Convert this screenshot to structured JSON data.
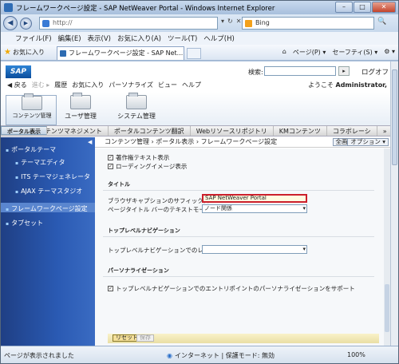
{
  "window": {
    "title": "フレームワークページ設定 - SAP NetWeaver Portal - Windows Internet Explorer",
    "min": "–",
    "max": "□",
    "close": "✕"
  },
  "addressbar": {
    "back_icon": "◀",
    "forward_icon": "▶",
    "url": "http://",
    "search_text": "Bing",
    "search_icon": "🔍",
    "icons": [
      "▾",
      "↻",
      "✕"
    ]
  },
  "menubar": [
    "ファイル(F)",
    "編集(E)",
    "表示(V)",
    "お気に入り(A)",
    "ツール(T)",
    "ヘルプ(H)"
  ],
  "favbar": {
    "favorites": "お気に入り",
    "tab_title": "フレームワークページ設定 - SAP Net...",
    "page_menu": "ページ(P) ▾",
    "safety_menu": "セーフティ(S) ▾",
    "tools_icon": "⚙ ▾"
  },
  "sap": {
    "logo": "SAP",
    "search_label": "検索:",
    "search_btn": "▸",
    "logoff": "ログオフ",
    "toolbar": {
      "back": "◀ 戻る",
      "forward": "進む ▸",
      "history": "履歴",
      "favorites": "お気に入り",
      "personalize": "パーソナライズ",
      "view": "ビュー",
      "help": "ヘルプ"
    },
    "welcome": "ようこそ",
    "user": "Administrator,"
  },
  "roles": [
    "コンテンツ管理",
    "ユーザ管理",
    "システム管理"
  ],
  "subnav": [
    "ポータルコンテンツマネジメント",
    "ポータルコンテンツ翻訳",
    "ポータル表示",
    "Webリソースリポジトリ",
    "KMコンテンツ",
    "コラボレーシ"
  ],
  "subnav_more": "»",
  "side": {
    "collapse": "◀",
    "items": [
      "ポータルテーマ",
      "テーマエディタ",
      "ITS テーマジェネレータ",
      "AJAX テーマスタジオ",
      "フレームワークページ設定",
      "タブセット"
    ]
  },
  "crumb": "コンテンツ管理 › ポータル表示 › フレームワークページ設定",
  "full_btn": "全画面",
  "opt_btn": "オプション ▾",
  "form": {
    "chk1": "著作権テキスト表示",
    "chk2": "ローディングイメージ表示",
    "sec_title": "タイトル",
    "suffix_label": "ブラウザキャプションのサフィックス",
    "suffix_value": "SAP NetWeaver Portal",
    "text_mode_label": "ページタイトル バーのテキストモード :",
    "text_mode_value": "ノード関係",
    "sec_nav": "トップレベルナビゲーション",
    "nav_level_label": "トップレベルナビゲーションでのレベル数 :",
    "nav_level_value": "",
    "sec_personal": "パーソナライゼーション",
    "chk3": "トップレベルナビゲーションでのエントリポイントのパーソナライゼーションをサポート",
    "reset_btn": "リセット",
    "save_btn": "保存",
    "check_mark": "✓",
    "dropdown_arrow": "▾"
  },
  "status": {
    "left": "ページが表示されました",
    "middle": "インターネット | 保護モード: 無効",
    "zoom": "100%"
  }
}
